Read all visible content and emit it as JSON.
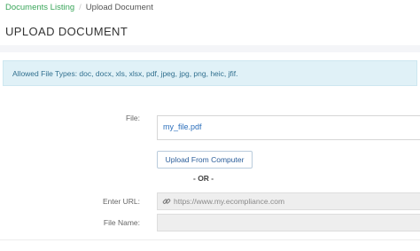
{
  "breadcrumb": {
    "parent_label": "Documents Listing",
    "separator": "/",
    "current_label": "Upload Document"
  },
  "page": {
    "title": "UPLOAD DOCUMENT"
  },
  "info": {
    "allowed_types_text": "Allowed File Types: doc, docx, xls, xlsx, pdf, jpeg, jpg, png, heic, jfif."
  },
  "form": {
    "file_label": "File:",
    "file_value": "my_file.pdf",
    "upload_button_label": "Upload From Computer",
    "or_divider": "- OR -",
    "url_label": "Enter URL:",
    "url_placeholder": "https://www.my.ecompliance.com",
    "url_icon": "link-icon",
    "file_name_label": "File Name:",
    "file_name_value": ""
  },
  "colors": {
    "breadcrumb_link": "#3aa65a",
    "info_background": "#e0f1f7",
    "info_text": "#31708f",
    "file_link": "#2a6ebb",
    "button_text": "#2a5d9a",
    "disabled_field": "#eeeeee"
  }
}
